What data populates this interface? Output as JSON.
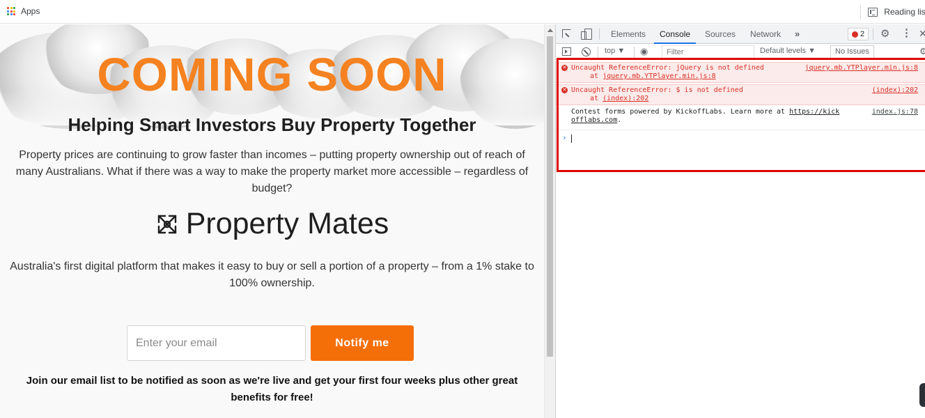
{
  "bookmarks": {
    "apps_label": "Apps",
    "reading_list_label": "Reading list"
  },
  "site": {
    "hero_title": "COMING SOON",
    "tagline": "Helping Smart Investors Buy Property Together",
    "intro": "Property prices are continuing to grow faster than incomes – putting property ownership out of reach of many Australians. What if there was a way to make the property market more accessible – regardless of budget?",
    "brand_name": "Property Mates",
    "description": "Australia's first digital platform that makes it easy to buy or sell a portion of a property – from a 1% stake to 100% ownership.",
    "email_placeholder": "Enter your email",
    "notify_label": "Notify me",
    "join_text": "Join our email list to be notified as soon as we're live and get your first four weeks plus other great benefits for free!"
  },
  "devtools": {
    "tabs": [
      "Elements",
      "Console",
      "Sources",
      "Network"
    ],
    "active_tab": "Console",
    "more_tabs": "»",
    "error_count": "2",
    "context": "top ▼",
    "filter_placeholder": "Filter",
    "levels_label": "Default levels ▼",
    "issues_label": "No Issues",
    "messages": [
      {
        "type": "error",
        "text": "Uncaught ReferenceError: jQuery is not defined",
        "at": "jquery.mb.YTPlayer.min.js:8",
        "source": "jquery.mb.YTPlayer.min.js:8"
      },
      {
        "type": "error",
        "text": "Uncaught ReferenceError: $ is not defined",
        "at": "(index):202",
        "source": "(index):202"
      },
      {
        "type": "log",
        "text": "Contest forms powered by KickoffLabs. Learn more at ",
        "link1": "https://kick",
        "link2": "offlabs.com",
        "after": ".",
        "source": "index.js:78"
      }
    ],
    "prompt": "›"
  },
  "colors": {
    "accent_orange": "#f56f08",
    "title_orange": "#f58220",
    "error_red": "#d93025",
    "highlight_red": "#e00000",
    "devtools_blue": "#1a73e8"
  }
}
